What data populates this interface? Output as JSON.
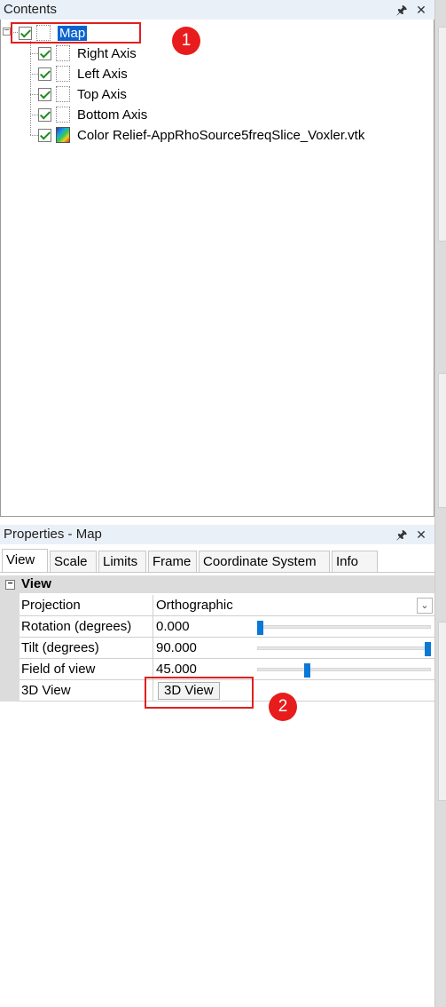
{
  "contents_pane": {
    "title": "Contents",
    "pin_glyph": "⚓",
    "close_glyph": "✕",
    "tree": {
      "root": {
        "label": "Map",
        "checked": true,
        "selected": true
      },
      "children": [
        {
          "label": "Right Axis",
          "checked": true,
          "icon": "axis-icon"
        },
        {
          "label": "Left Axis",
          "checked": true,
          "icon": "axis-icon"
        },
        {
          "label": "Top Axis",
          "checked": true,
          "icon": "axis-icon"
        },
        {
          "label": "Bottom Axis",
          "checked": true,
          "icon": "axis-icon"
        },
        {
          "label": "Color Relief-AppRhoSource5freqSlice_Voxler.vtk",
          "checked": true,
          "icon": "color-relief-icon"
        }
      ]
    }
  },
  "properties_pane": {
    "title": "Properties - Map",
    "tabs": [
      "View",
      "Scale",
      "Limits",
      "Frame",
      "Coordinate System",
      "Info"
    ],
    "active_tab": "View",
    "section": {
      "expander": "−",
      "label": "View"
    },
    "rows": {
      "projection": {
        "label": "Projection",
        "value": "Orthographic"
      },
      "rotation": {
        "label": "Rotation (degrees)",
        "value": "0.000",
        "slider_fraction": 0.0
      },
      "tilt": {
        "label": "Tilt (degrees)",
        "value": "90.000",
        "slider_fraction": 1.0
      },
      "fov": {
        "label": "Field of view",
        "value": "45.000",
        "slider_fraction": 0.28
      },
      "view3d": {
        "label": "3D View",
        "button_label": "3D View"
      }
    }
  },
  "annotations": {
    "marker1": "1",
    "marker2": "2",
    "color": "#e02020"
  },
  "colors": {
    "selection": "#0a64d0",
    "slider_thumb": "#0a78d7",
    "checkmark": "#1a8c1a"
  }
}
